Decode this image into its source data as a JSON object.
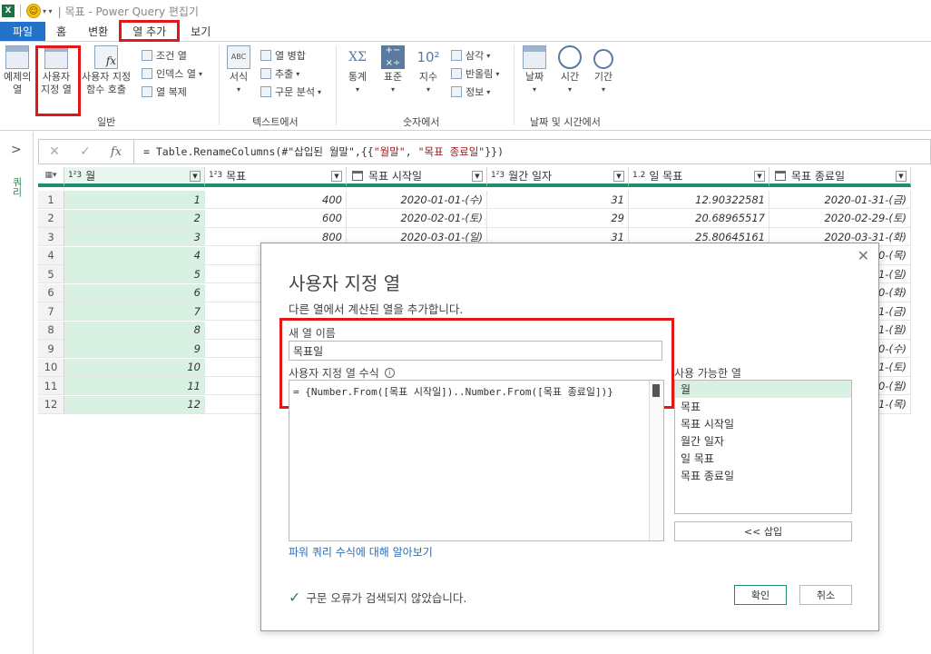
{
  "window": {
    "title": "목표 - Power Query 편집기",
    "app_icon": "X"
  },
  "menu": {
    "tabs": [
      "파일",
      "홈",
      "변환",
      "열 추가",
      "보기"
    ]
  },
  "ribbon": {
    "examples_btn": [
      "예제의",
      "열"
    ],
    "custom_col_btn": [
      "사용자",
      "지정 열"
    ],
    "invoke_fn_btn": [
      "사용자 지정",
      "함수 호출"
    ],
    "conditional_col": "조건 열",
    "index_col": "인덱스 열",
    "duplicate_col": "열 복제",
    "group_general": "일반",
    "format": "서식",
    "merge_cols": "열 병합",
    "extract": "추출",
    "parse": "구문 분석",
    "group_text": "텍스트에서",
    "stats": "통계",
    "standard": "표준",
    "scientific": "지수",
    "trig": "삼각",
    "rounding": "반올림",
    "info": "정보",
    "group_number": "숫자에서",
    "date": "날짜",
    "time": "시간",
    "duration": "기간",
    "group_datetime": "날짜 및 시간에서"
  },
  "left_pane": {
    "label": "쿼리"
  },
  "formula_bar": {
    "prefix": "= Table.RenameColumns(#\"삽입된 월말\",{{",
    "str1": "\"월말\"",
    "sep": ", ",
    "str2": "\"목표 종료일\"",
    "suffix": "}})"
  },
  "grid": {
    "columns": [
      {
        "type": "1²3",
        "name": "월"
      },
      {
        "type": "1²3",
        "name": "목표"
      },
      {
        "type": "cal",
        "name": "목표 시작일"
      },
      {
        "type": "1²3",
        "name": "월간 일자"
      },
      {
        "type": "1.2",
        "name": "일 목표"
      },
      {
        "type": "cal",
        "name": "목표 종료일"
      }
    ],
    "rows": [
      {
        "n": "1",
        "c": [
          "1",
          "400",
          "2020-01-01-(수)",
          "31",
          "12.90322581",
          "2020-01-31-(금)"
        ]
      },
      {
        "n": "2",
        "c": [
          "2",
          "600",
          "2020-02-01-(토)",
          "29",
          "20.68965517",
          "2020-02-29-(토)"
        ]
      },
      {
        "n": "3",
        "c": [
          "3",
          "800",
          "2020-03-01-(일)",
          "31",
          "25.80645161",
          "2020-03-31-(화)"
        ]
      },
      {
        "n": "4",
        "c": [
          "4",
          "",
          "",
          "",
          "",
          "30-(목)"
        ]
      },
      {
        "n": "5",
        "c": [
          "5",
          "",
          "",
          "",
          "",
          "31-(일)"
        ]
      },
      {
        "n": "6",
        "c": [
          "6",
          "",
          "",
          "",
          "",
          "30-(화)"
        ]
      },
      {
        "n": "7",
        "c": [
          "7",
          "",
          "",
          "",
          "",
          "31-(금)"
        ]
      },
      {
        "n": "8",
        "c": [
          "8",
          "",
          "",
          "",
          "",
          "31-(월)"
        ]
      },
      {
        "n": "9",
        "c": [
          "9",
          "",
          "",
          "",
          "",
          "30-(수)"
        ]
      },
      {
        "n": "10",
        "c": [
          "10",
          "",
          "",
          "",
          "",
          "31-(토)"
        ]
      },
      {
        "n": "11",
        "c": [
          "11",
          "",
          "",
          "",
          "",
          "30-(월)"
        ]
      },
      {
        "n": "12",
        "c": [
          "12",
          "",
          "",
          "",
          "",
          "31-(목)"
        ]
      }
    ]
  },
  "dialog": {
    "title": "사용자 지정 열",
    "subtitle": "다른 열에서 계산된 열을 추가합니다.",
    "name_label": "새 열 이름",
    "name_value": "목표일",
    "formula_label": "사용자 지정 열 수식",
    "formula": "= {Number.From([목표 시작일])..Number.From([목표 종료일])}",
    "available_label": "사용 가능한 열",
    "available_columns": [
      "월",
      "목표",
      "목표 시작일",
      "월간 일자",
      "일 목표",
      "목표 종료일"
    ],
    "insert_btn": "<< 삽입",
    "learn_link": "파워 쿼리 수식에 대해 알아보기",
    "status": "구문 오류가 검색되지 않았습니다.",
    "ok": "확인",
    "cancel": "취소"
  }
}
